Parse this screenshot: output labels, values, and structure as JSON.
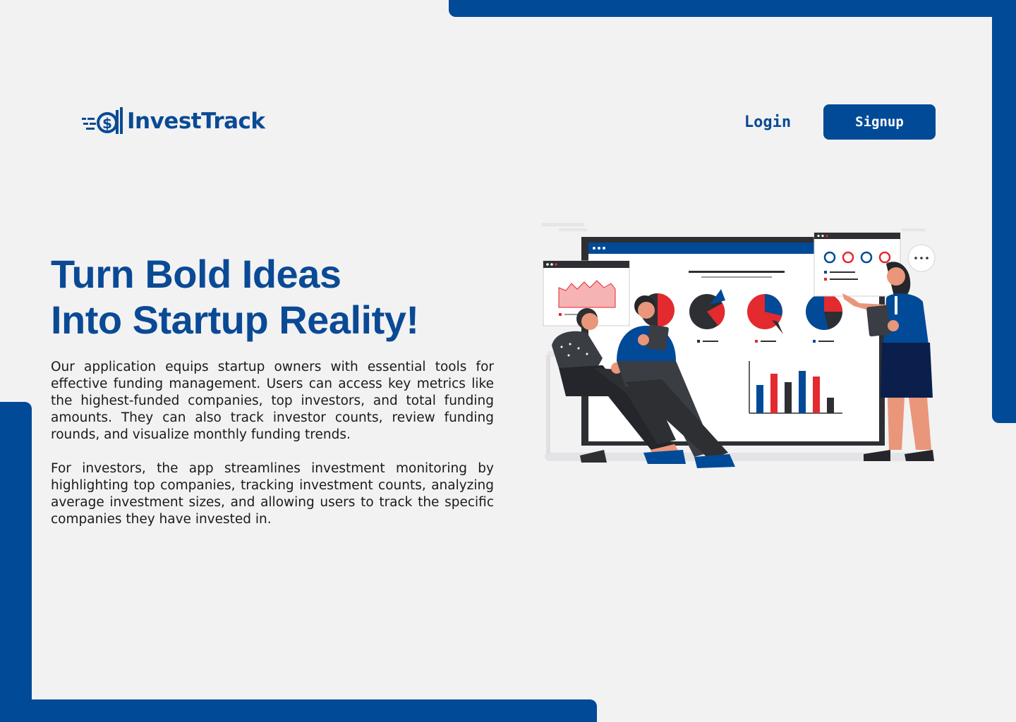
{
  "brand": {
    "name": "InvestTrack",
    "primary_color": "#004a98",
    "accent_red": "#e32a2f",
    "background": "#f2f2f3",
    "logo_icon": "dollar-speed-icon"
  },
  "nav": {
    "login_label": "Login",
    "signup_label": "Signup"
  },
  "hero": {
    "title_line1": "Turn Bold Ideas",
    "title_line2": "Into Startup Reality!",
    "paragraph1": "Our application equips startup owners with essential tools for effective funding management. Users can access key metrics like the highest-funded companies, top investors, and total funding amounts. They can also track investor counts, review funding rounds, and visualize monthly funding trends.",
    "paragraph2": "For investors, the app streamlines investment monitoring by highlighting top companies, tracking investment counts, analyzing average investment sizes, and allowing users to track the specific companies they have invested in."
  },
  "illustration": {
    "icon": "team-analytics-illustration",
    "speech_bubble_text": "···"
  }
}
